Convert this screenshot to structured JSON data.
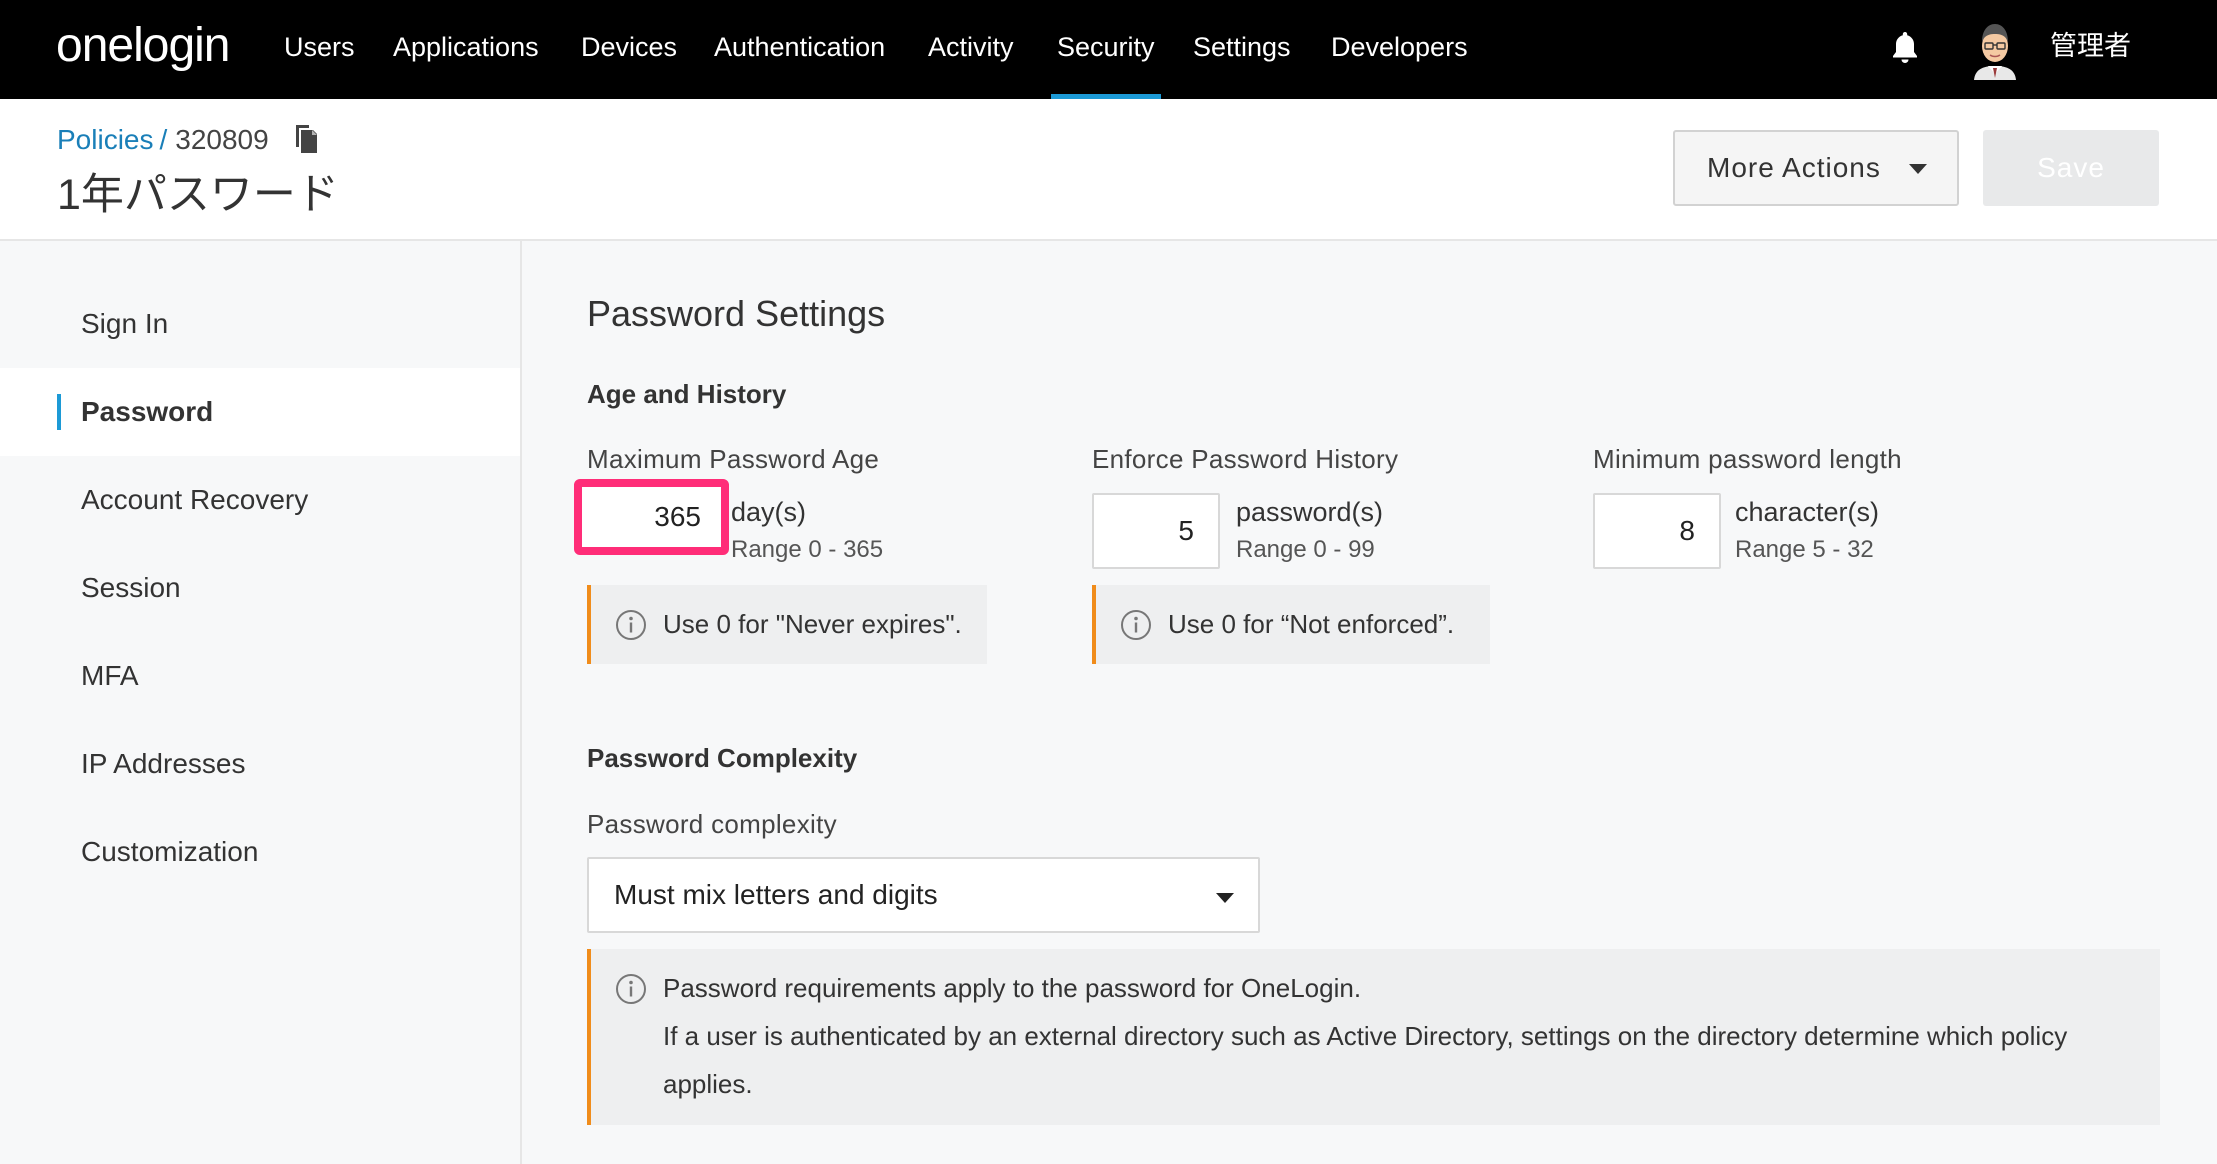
{
  "nav": {
    "logo": "onelogin",
    "items": [
      {
        "label": "Users"
      },
      {
        "label": "Applications"
      },
      {
        "label": "Devices"
      },
      {
        "label": "Authentication"
      },
      {
        "label": "Activity"
      },
      {
        "label": "Security",
        "active": true
      },
      {
        "label": "Settings"
      },
      {
        "label": "Developers"
      }
    ],
    "user_name": "管理者"
  },
  "header": {
    "breadcrumb_link": "Policies",
    "breadcrumb_sep": "/",
    "policy_id": "320809",
    "title": "1年パスワード",
    "more_actions_label": "More Actions",
    "save_label": "Save"
  },
  "sidebar": {
    "items": [
      {
        "label": "Sign In"
      },
      {
        "label": "Password",
        "active": true
      },
      {
        "label": "Account Recovery"
      },
      {
        "label": "Session"
      },
      {
        "label": "MFA"
      },
      {
        "label": "IP Addresses"
      },
      {
        "label": "Customization"
      }
    ]
  },
  "main": {
    "section_title": "Password Settings",
    "age_history": {
      "title": "Age and History",
      "max_age": {
        "label": "Maximum Password Age",
        "value": "365",
        "unit": "day(s)",
        "range": "Range 0 - 365",
        "note": "Use 0 for \"Never expires\"."
      },
      "history": {
        "label": "Enforce Password History",
        "value": "5",
        "unit": "password(s)",
        "range": "Range 0 - 99",
        "note": "Use 0 for “Not enforced”."
      },
      "min_length": {
        "label": "Minimum password length",
        "value": "8",
        "unit": "character(s)",
        "range": "Range 5 - 32"
      }
    },
    "complexity": {
      "title": "Password Complexity",
      "label": "Password complexity",
      "selected": "Must mix letters and digits",
      "note_line1": "Password requirements apply to the password for OneLogin.",
      "note_line2": "If a user is authenticated by an external directory such as Active Directory, settings on the directory determine which policy",
      "note_line3": "applies."
    }
  },
  "colors": {
    "accent": "#1c9ad6",
    "highlight": "#ff2d78",
    "note_border": "#f08c1b",
    "link": "#1a7fb8"
  }
}
